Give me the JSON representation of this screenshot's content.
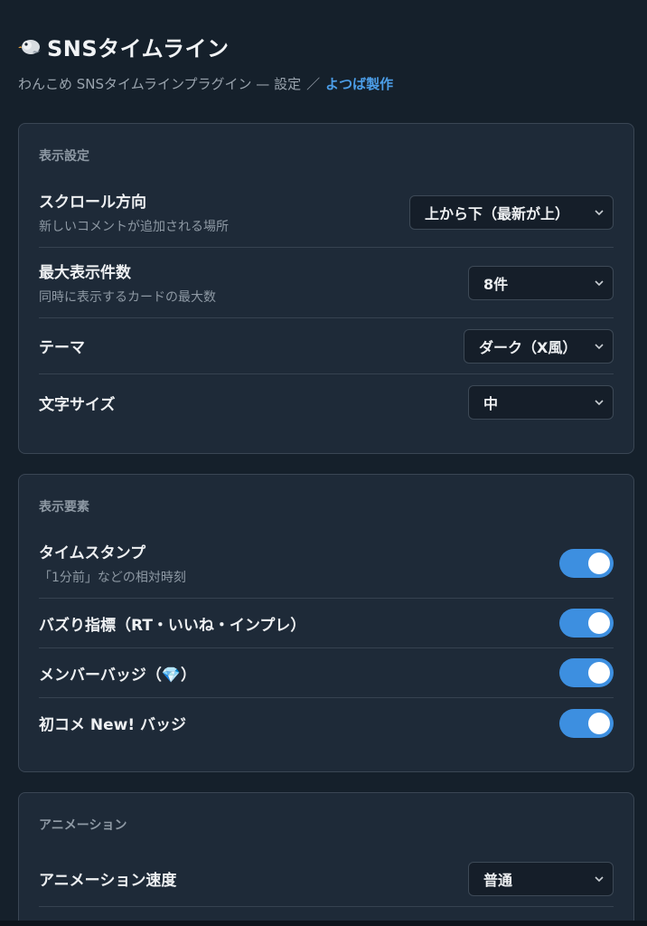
{
  "header": {
    "title": "SNSタイムライン",
    "subtitle_main": "わんこめ SNSタイムラインプラグイン — 設定",
    "subtitle_sep": "／",
    "subtitle_author": "よつば製作"
  },
  "display_settings": {
    "title": "表示設定",
    "scroll": {
      "label": "スクロール方向",
      "desc": "新しいコメントが追加される場所",
      "value": "上から下（最新が上）"
    },
    "max_count": {
      "label": "最大表示件数",
      "desc": "同時に表示するカードの最大数",
      "value": "8件"
    },
    "theme": {
      "label": "テーマ",
      "value": "ダーク（X風）"
    },
    "font_size": {
      "label": "文字サイズ",
      "value": "中"
    }
  },
  "display_elements": {
    "title": "表示要素",
    "timestamp": {
      "label": "タイムスタンプ",
      "desc": "「1分前」などの相対時刻",
      "on": true
    },
    "buzz": {
      "label": "バズり指標（RT・いいね・インプレ）",
      "on": true
    },
    "member_badge": {
      "label": "メンバーバッジ（💎）",
      "on": true
    },
    "first_comment": {
      "label": "初コメ New! バッジ",
      "on": true
    }
  },
  "animation": {
    "title": "アニメーション",
    "speed": {
      "label": "アニメーション速度",
      "value": "普通"
    }
  },
  "colors": {
    "background": "#15202b",
    "card": "#1e2a38",
    "accent": "#3d8fe0",
    "author_link": "#4c9ee8"
  }
}
